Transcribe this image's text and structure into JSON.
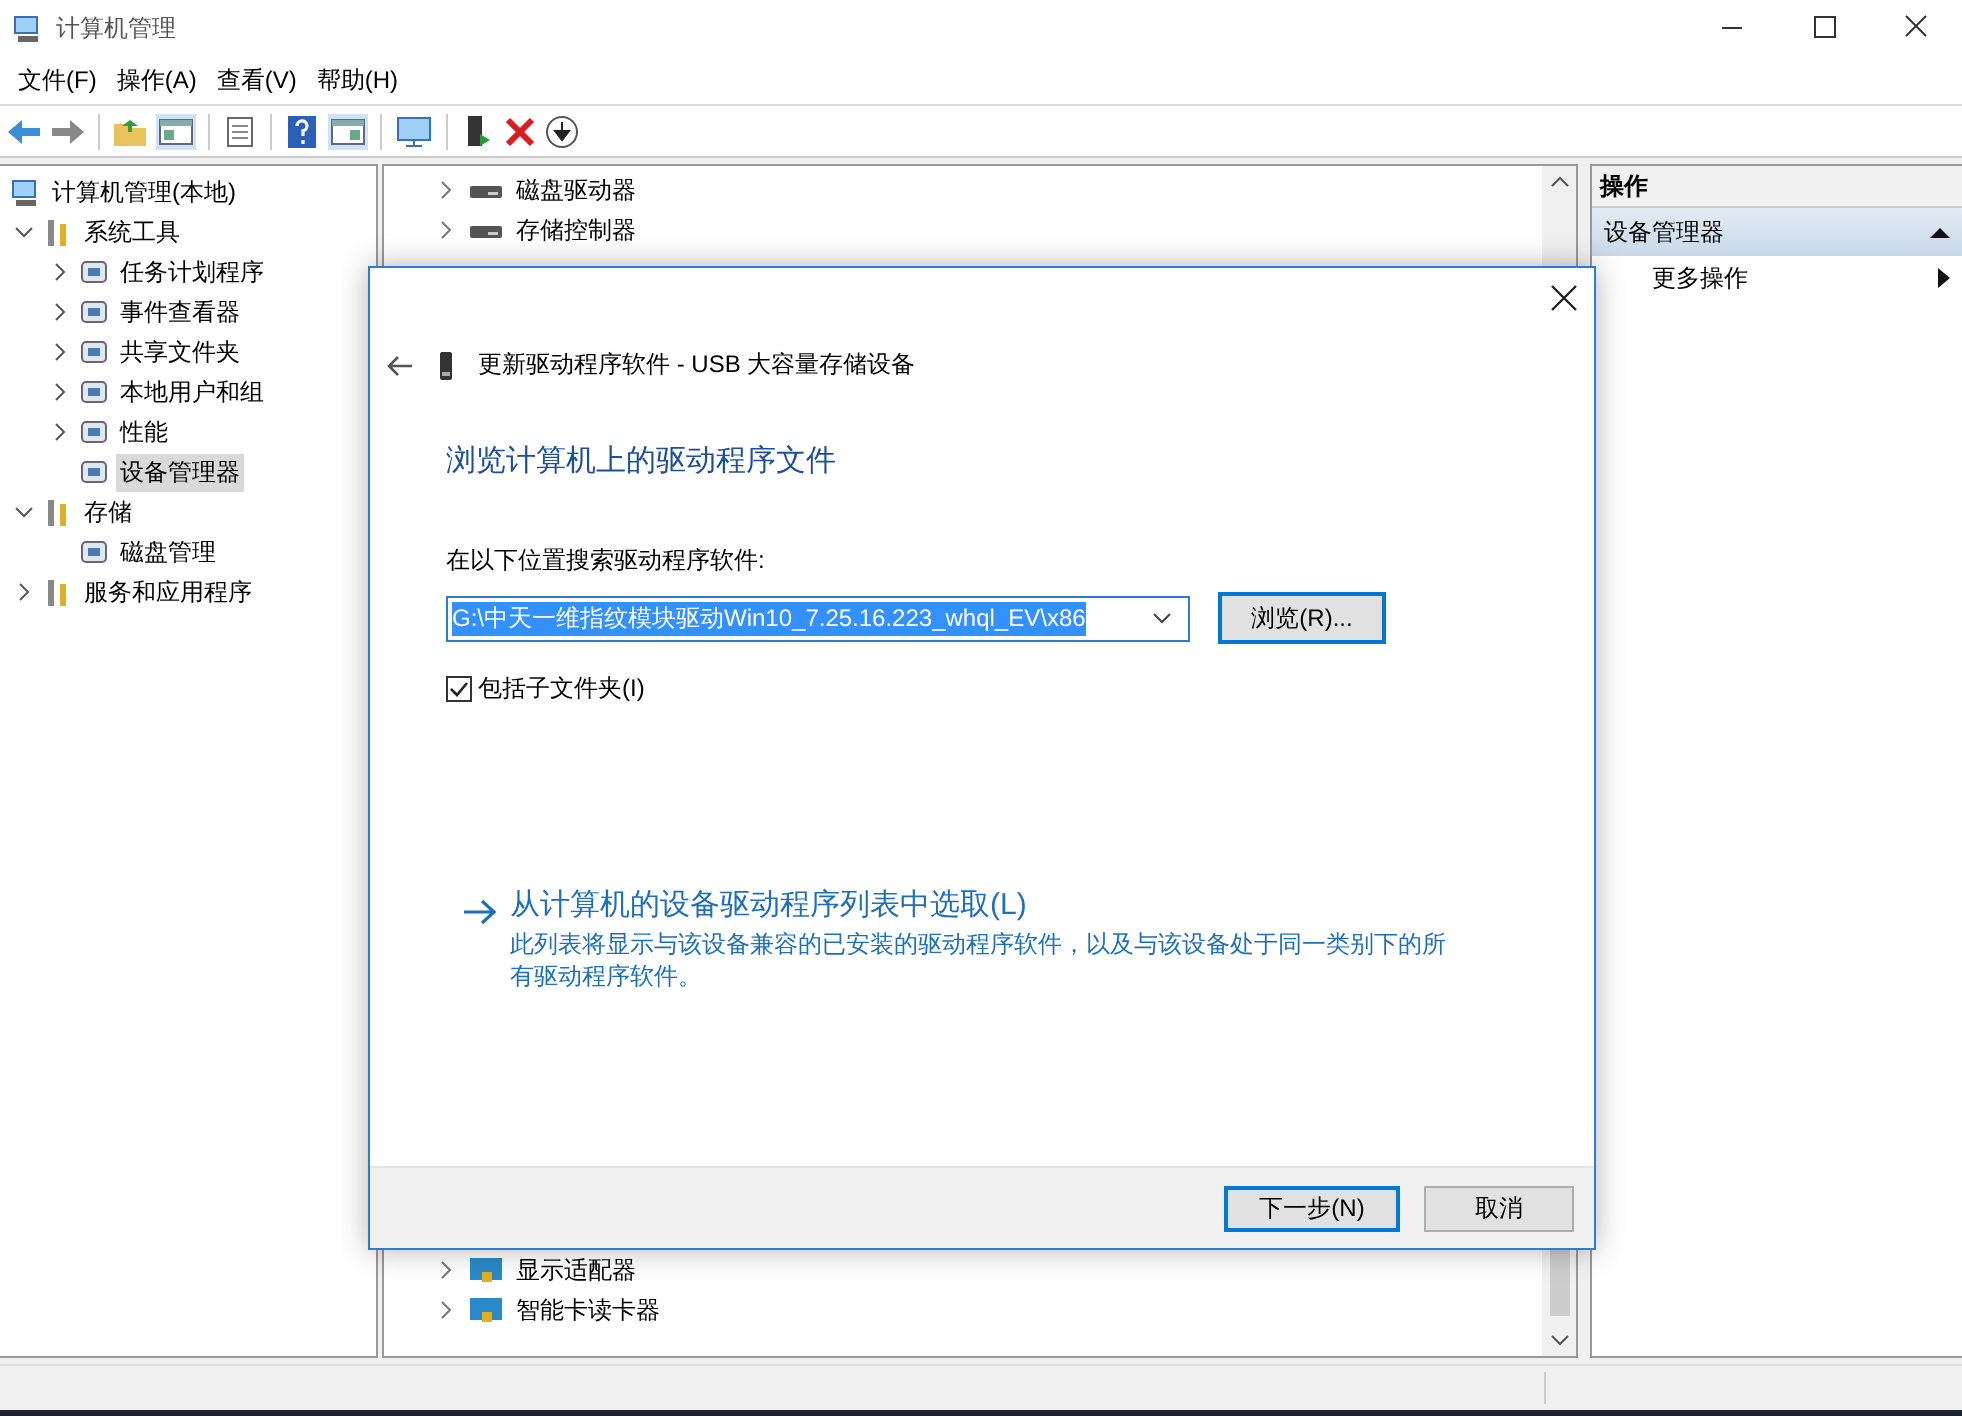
{
  "window": {
    "title": "计算机管理"
  },
  "menu": [
    "文件(F)",
    "操作(A)",
    "查看(V)",
    "帮助(H)"
  ],
  "tree": {
    "label": "计算机管理(本地)",
    "children": [
      {
        "label": "系统工具",
        "expanded": true,
        "children": [
          {
            "label": "任务计划程序",
            "expanded": false,
            "selected": false
          },
          {
            "label": "事件查看器",
            "expanded": false,
            "selected": false
          },
          {
            "label": "共享文件夹",
            "expanded": false,
            "selected": false
          },
          {
            "label": "本地用户和组",
            "expanded": false,
            "selected": false
          },
          {
            "label": "性能",
            "expanded": false,
            "selected": false
          },
          {
            "label": "设备管理器",
            "selected": true
          }
        ]
      },
      {
        "label": "存储",
        "expanded": true,
        "children": [
          {
            "label": "磁盘管理",
            "selected": false
          }
        ]
      },
      {
        "label": "服务和应用程序",
        "expanded": false
      }
    ]
  },
  "devices_above": [
    {
      "label": "磁盘驱动器",
      "expanded": false
    },
    {
      "label": "存储控制器",
      "expanded": false
    }
  ],
  "devices_below": [
    {
      "label": "显示适配器",
      "expanded": false
    },
    {
      "label": "智能卡读卡器",
      "expanded": false
    }
  ],
  "actions": {
    "header": "操作",
    "section": {
      "label": "设备管理器",
      "expanded": true
    },
    "items": [
      "更多操作"
    ]
  },
  "dialog": {
    "title": "更新驱动程序软件 - USB 大容量存储设备",
    "heading": "浏览计算机上的驱动程序文件",
    "path_label": "在以下位置搜索驱动程序软件:",
    "path_value": "G:\\中天一维指纹模块驱动Win10_7.25.16.223_whql_EV\\x86",
    "browse_button": "浏览(R)...",
    "include_subfolders": {
      "label": "包括子文件夹(I)",
      "checked": true
    },
    "link_title": "从计算机的设备驱动程序列表中选取(L)",
    "link_description": "此列表将显示与该设备兼容的已安装的驱动程序软件，以及与该设备处于同一类别下的所有驱动程序软件。",
    "buttons": [
      {
        "label": "下一步(N)",
        "default": true
      },
      {
        "label": "取消",
        "default": false
      }
    ]
  }
}
